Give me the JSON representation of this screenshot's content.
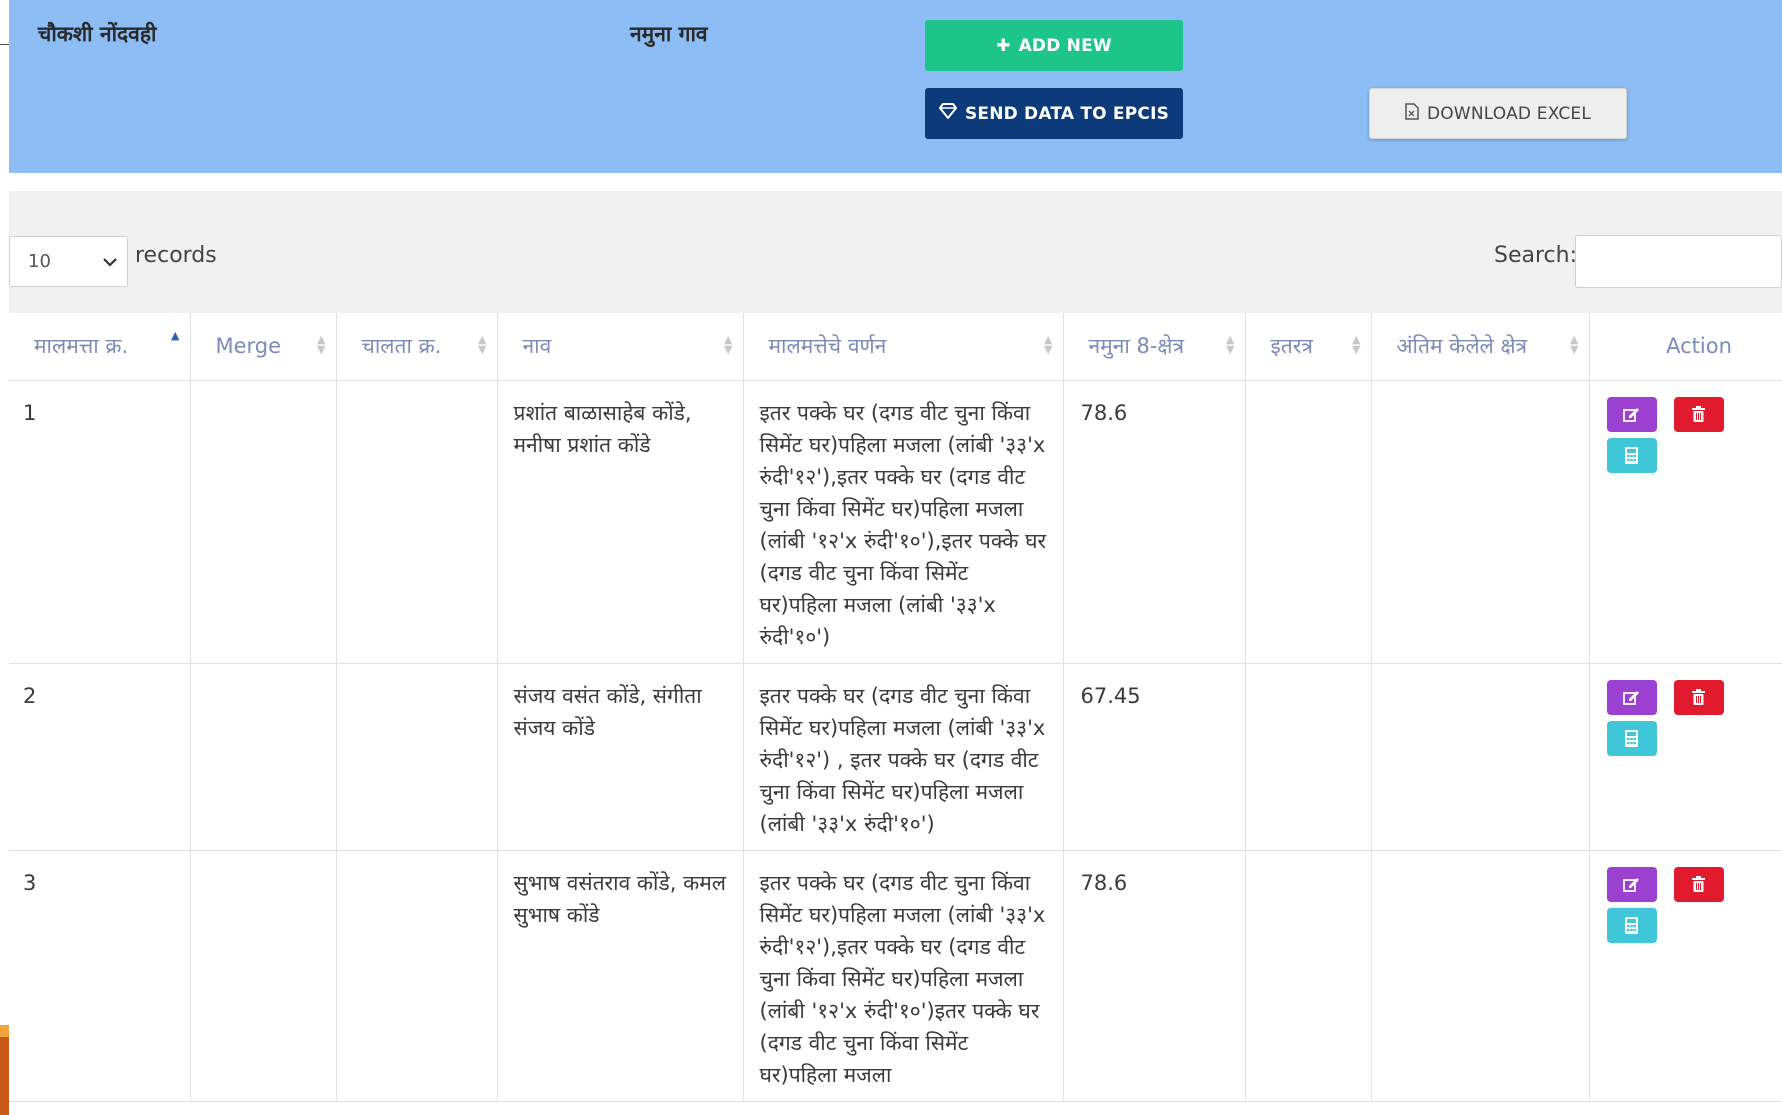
{
  "header": {
    "title": "चौकशी नोंदवही",
    "village": "नमुना गाव",
    "add_new": "ADD NEW",
    "send_data": "SEND DATA TO EPCIS",
    "download_excel": "DOWNLOAD EXCEL"
  },
  "controls": {
    "page_length": "10",
    "records_label": "records",
    "search_label": "Search:",
    "search_value": ""
  },
  "table": {
    "columns": [
      "मालमत्ता क्र.",
      "Merge",
      "चालता क्र.",
      "नाव",
      "मालमत्तेचे वर्णन",
      "नमुना 8-क्षेत्र",
      "इतरत्र",
      "अंतिम केलेले क्षेत्र",
      "Action"
    ],
    "rows": [
      {
        "no": "1",
        "merge": "",
        "chalta": "",
        "name": "प्रशांत बाळासाहेब कोंडे, मनीषा प्रशांत कोंडे",
        "desc": "इतर पक्के घर (दगड वीट चुना किंवा सिमेंट घर)पहिला मजला (लांबी '३३'x रुंदी'१२'),इतर पक्के घर (दगड वीट चुना किंवा सिमेंट घर)पहिला मजला (लांबी '१२'x रुंदी'१०'),इतर पक्के घर (दगड वीट चुना किंवा सिमेंट घर)पहिला मजला (लांबी '३३'x रुंदी'१०')",
        "area": "78.6",
        "other": "",
        "final": ""
      },
      {
        "no": "2",
        "merge": "",
        "chalta": "",
        "name": "संजय वसंत कोंडे, संगीता संजय कोंडे",
        "desc": "इतर पक्के घर (दगड वीट चुना किंवा सिमेंट घर)पहिला मजला (लांबी '३३'x रुंदी'१२') , इतर पक्के घर (दगड वीट चुना किंवा सिमेंट घर)पहिला मजला (लांबी '३३'x रुंदी'१०')",
        "area": "67.45",
        "other": "",
        "final": ""
      },
      {
        "no": "3",
        "merge": "",
        "chalta": "",
        "name": "सुभाष वसंतराव कोंडे, कमल सुभाष कोंडे",
        "desc": "इतर पक्के घर (दगड वीट चुना किंवा सिमेंट घर)पहिला मजला (लांबी '३३'x रुंदी'१२'),इतर पक्के घर (दगड वीट चुना किंवा सिमेंट घर)पहिला मजला (लांबी '१२'x रुंदी'१०')इतर पक्के घर (दगड वीट चुना किंवा सिमेंट घर)पहिला मजला",
        "area": "78.6",
        "other": "",
        "final": ""
      }
    ]
  },
  "colors": {
    "header_bg": "#8cbdf5",
    "add_btn": "#1ec58b",
    "send_btn": "#0d3a7a",
    "edit_btn": "#9b40d0",
    "delete_btn": "#e11b2d",
    "calc_btn": "#3fc6d8"
  },
  "icons": {
    "add": "plus-icon",
    "send": "diamond-icon",
    "excel": "file-icon",
    "edit": "edit-icon",
    "delete": "trash-icon",
    "calc": "calculator-icon"
  }
}
